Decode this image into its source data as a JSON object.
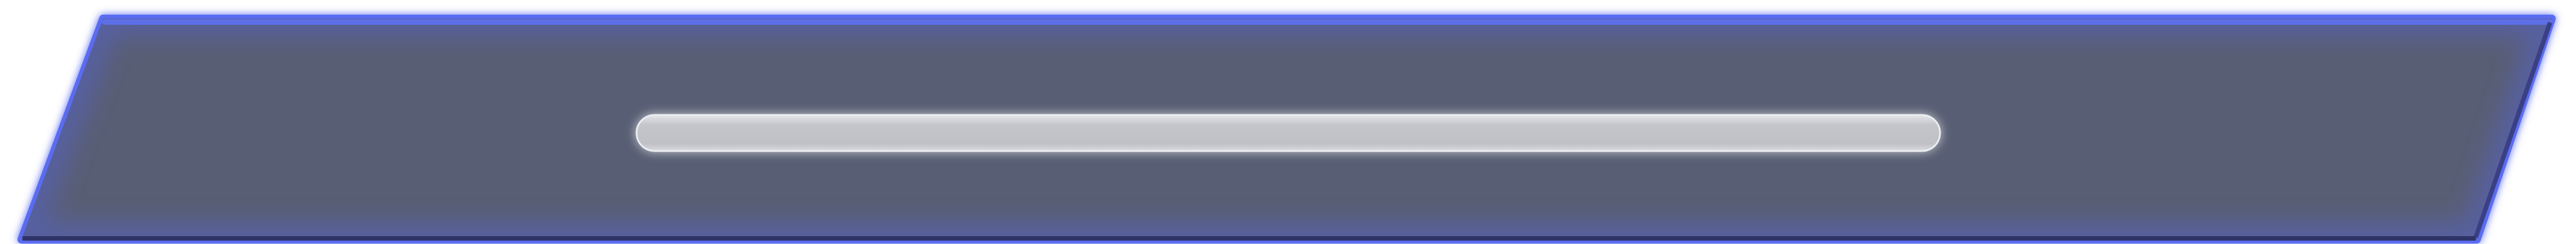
{
  "panel": {
    "shape": "parallelogram",
    "fill_color": "#585e73",
    "border_glow_color": "#5a6cf0",
    "top_edge_color": "#5d6fe6",
    "bottom_edge_color": "#2f3468"
  },
  "slot": {
    "fill_color": "#c3c5ca",
    "highlight_color": "#e4e6ea",
    "glow_color": "#d6d8de",
    "empty": true
  }
}
